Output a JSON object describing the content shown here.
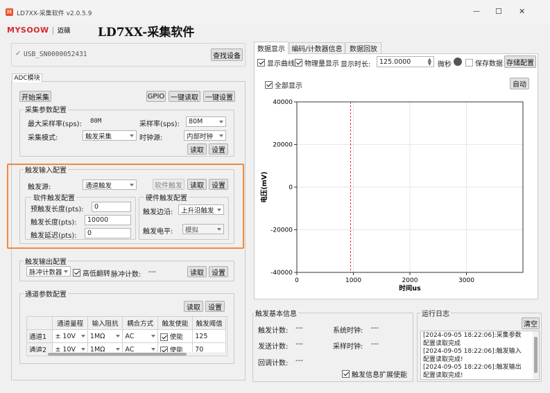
{
  "window": {
    "title": "LD7XX-采集软件 v2.0.5.9",
    "minimize": "—",
    "maximize": "☐",
    "close": "✕"
  },
  "header": {
    "logo_text": "MYSOOW",
    "logo_sub": "迈硕",
    "app_title": "LD7XX-采集软件"
  },
  "device": {
    "name": "USB_SN0000052431",
    "find_button": "查找设备"
  },
  "adc_tab": "ADC模块",
  "toolbar": {
    "start": "开始采集",
    "gpio": "GPIO",
    "read_all": "一键读取",
    "set_all": "一键设置"
  },
  "acq": {
    "title": "采集参数配置",
    "max_rate_label": "最大采样率(sps):",
    "max_rate_value": "80M",
    "rate_label": "采样率(sps):",
    "rate_value": "80M",
    "mode_label": "采集模式:",
    "mode_value": "触发采集",
    "clock_label": "时钟源:",
    "clock_value": "内部时钟",
    "read": "读取",
    "set": "设置"
  },
  "trigger": {
    "title": "触发输入配置",
    "source_label": "触发源:",
    "source_value": "通道触发",
    "soft_btn": "软件触发",
    "read": "读取",
    "set": "设置",
    "soft": {
      "title": "软件触发配置",
      "pre_label": "预触发长度(pts):",
      "pre_value": "0",
      "len_label": "触发长度(pts):",
      "len_value": "10000",
      "delay_label": "触发延迟(pts):",
      "delay_value": "0"
    },
    "hard": {
      "title": "硬件触发配置",
      "edge_label": "触发边沿:",
      "edge_value": "上升沿触发",
      "level_label": "触发电平:",
      "level_value": "模拟"
    }
  },
  "trig_out": {
    "title": "触发输出配置",
    "mode_value": "脉冲计数器",
    "invert_label": "高低翻转",
    "count_label": "脉冲计数:",
    "count_value": "---",
    "read": "读取",
    "set": "设置"
  },
  "channel": {
    "title": "通道参数配置",
    "read": "读取",
    "set": "设置",
    "headers": [
      "",
      "通道量程",
      "输入阻抗",
      "耦合方式",
      "触发使能",
      "触发阈值"
    ],
    "rows": [
      {
        "name": "通道1",
        "range": "± 10V",
        "imp": "1MΩ",
        "coupling": "AC",
        "enable": "使能",
        "threshold": "125"
      },
      {
        "name": "通道2",
        "range": "± 10V",
        "imp": "1MΩ",
        "coupling": "AC",
        "enable": "使能",
        "threshold": "70"
      }
    ]
  },
  "tabs": [
    "数据显示",
    "编码/计数器信息",
    "数据回放"
  ],
  "display": {
    "show_curve": "显示曲线",
    "physical": "物理量显示",
    "time_label": "显示时长:",
    "time_value": "125.0000",
    "unit": "微秒",
    "save_data": "保存数据",
    "save_config": "存储配置",
    "show_all": "全部显示",
    "auto": "自动"
  },
  "chart_data": {
    "type": "line",
    "xlabel": "时间us",
    "ylabel": "电压(mV)",
    "xlim": [
      0,
      4000
    ],
    "ylim": [
      -40000,
      40000
    ],
    "xticks": [
      0,
      1000,
      2000,
      3000
    ],
    "yticks": [
      40000,
      20000,
      0,
      -20000,
      -40000
    ],
    "grid": true,
    "marker_x": 950,
    "series": []
  },
  "trig_info": {
    "title": "触发基本信息",
    "count_label": "触发计数:",
    "count_value": "---",
    "sys_clock_label": "系统时钟:",
    "sys_clock_value": "---",
    "send_label": "发送计数:",
    "send_value": "---",
    "sample_clock_label": "采样时钟:",
    "sample_clock_value": "---",
    "return_label": "回调计数:",
    "return_value": "---",
    "extend_label": "触发信息扩展使能"
  },
  "log": {
    "title": "运行日志",
    "clear": "清空",
    "lines": [
      "[2024-09-05 18:22:06]:采集参数",
      "配置读取完成",
      "[2024-09-05 18:22:06]:触发输入",
      "配置读取完成!",
      "[2024-09-05 18:22:06]:触发输出",
      "配置读取完成!"
    ]
  },
  "colors": {
    "highlight": "#f0883a",
    "marker": "#e0303a",
    "logo_red": "#d9262c"
  }
}
